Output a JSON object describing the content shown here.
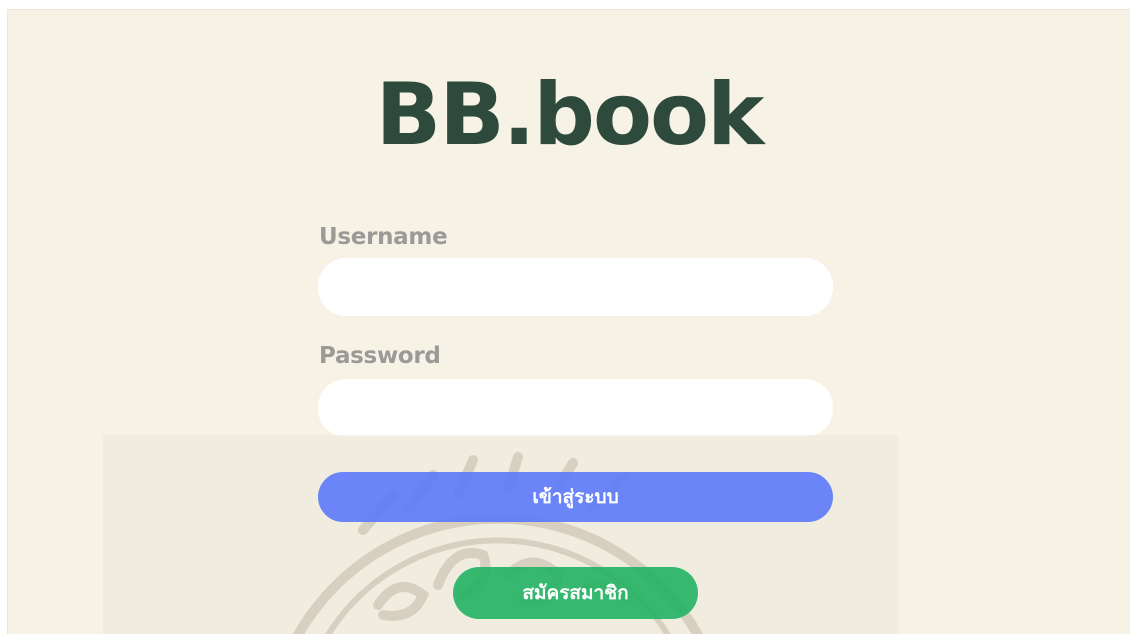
{
  "brand": {
    "title": "BB.book"
  },
  "form": {
    "username_label": "Username",
    "username_value": "",
    "password_label": "Password",
    "password_value": ""
  },
  "buttons": {
    "login_label": "เข้าสู่ระบบ",
    "register_label": "สมัครสมาชิก"
  },
  "colors": {
    "background": "#f6f2e5",
    "brand_text": "#2e4a3d",
    "label_text": "#9a9a97",
    "login_button": "#5876fa",
    "register_button": "#1cb060"
  }
}
